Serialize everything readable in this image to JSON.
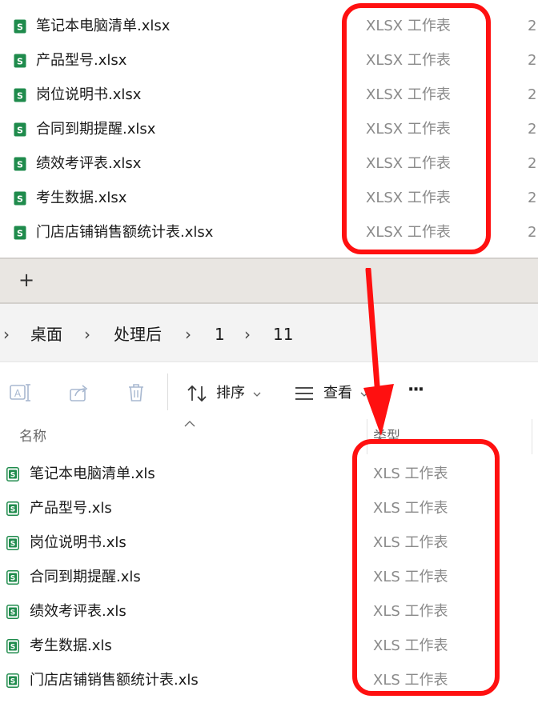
{
  "top_list": {
    "files": [
      {
        "name": "笔记本电脑清单.xlsx",
        "type": "XLSX 工作表",
        "date": "2"
      },
      {
        "name": "产品型号.xlsx",
        "type": "XLSX 工作表",
        "date": "2"
      },
      {
        "name": "岗位说明书.xlsx",
        "type": "XLSX 工作表",
        "date": "2"
      },
      {
        "name": "合同到期提醒.xlsx",
        "type": "XLSX 工作表",
        "date": "2"
      },
      {
        "name": "绩效考评表.xlsx",
        "type": "XLSX 工作表",
        "date": "2"
      },
      {
        "name": "考生数据.xlsx",
        "type": "XLSX 工作表",
        "date": "2"
      },
      {
        "name": "门店店铺销售额统计表.xlsx",
        "type": "XLSX 工作表",
        "date": "2"
      }
    ]
  },
  "tabbar": {
    "new_tab": "+"
  },
  "breadcrumb": {
    "items": [
      "桌面",
      "处理后",
      "1",
      "11"
    ],
    "separator": "›"
  },
  "toolbar": {
    "sort_label": "排序",
    "view_label": "查看",
    "more_label": "···"
  },
  "columns": {
    "name": "名称",
    "type": "类型"
  },
  "bottom_list": {
    "files": [
      {
        "name": "笔记本电脑清单.xls",
        "type": "XLS 工作表"
      },
      {
        "name": "产品型号.xls",
        "type": "XLS 工作表"
      },
      {
        "name": "岗位说明书.xls",
        "type": "XLS 工作表"
      },
      {
        "name": "合同到期提醒.xls",
        "type": "XLS 工作表"
      },
      {
        "name": "绩效考评表.xls",
        "type": "XLS 工作表"
      },
      {
        "name": "考生数据.xls",
        "type": "XLS 工作表"
      },
      {
        "name": "门店店铺销售额统计表.xls",
        "type": "XLS 工作表"
      }
    ]
  },
  "colors": {
    "highlight": "#ff1010",
    "excel_green": "#1f8b4c"
  }
}
